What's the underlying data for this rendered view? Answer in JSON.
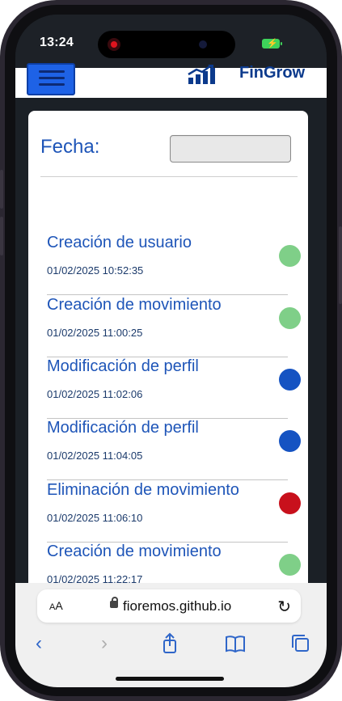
{
  "status_bar": {
    "time": "13:24"
  },
  "header": {
    "menu_button": "menu",
    "brand": "FinGrow"
  },
  "filter": {
    "label": "Fecha:",
    "value": ""
  },
  "activity": [
    {
      "title": "Creación de usuario",
      "datetime": "01/02/2025 10:52:35",
      "color": "#7fcf88"
    },
    {
      "title": "Creación de movimiento",
      "datetime": "01/02/2025 11:00:25",
      "color": "#7fcf88"
    },
    {
      "title": "Modificación de perfil",
      "datetime": "01/02/2025 11:02:06",
      "color": "#1553c2"
    },
    {
      "title": "Modificación de perfil",
      "datetime": "01/02/2025 11:04:05",
      "color": "#1553c2"
    },
    {
      "title": "Eliminación de movimiento",
      "datetime": "01/02/2025 11:06:10",
      "color": "#c8101c"
    },
    {
      "title": "Creación de movimiento",
      "datetime": "01/02/2025 11:22:17",
      "color": "#7fcf88"
    }
  ],
  "browser": {
    "text_size": "AA",
    "url": "fioremos.github.io",
    "toolbar": [
      "back",
      "forward",
      "share",
      "bookmarks",
      "tabs"
    ]
  }
}
